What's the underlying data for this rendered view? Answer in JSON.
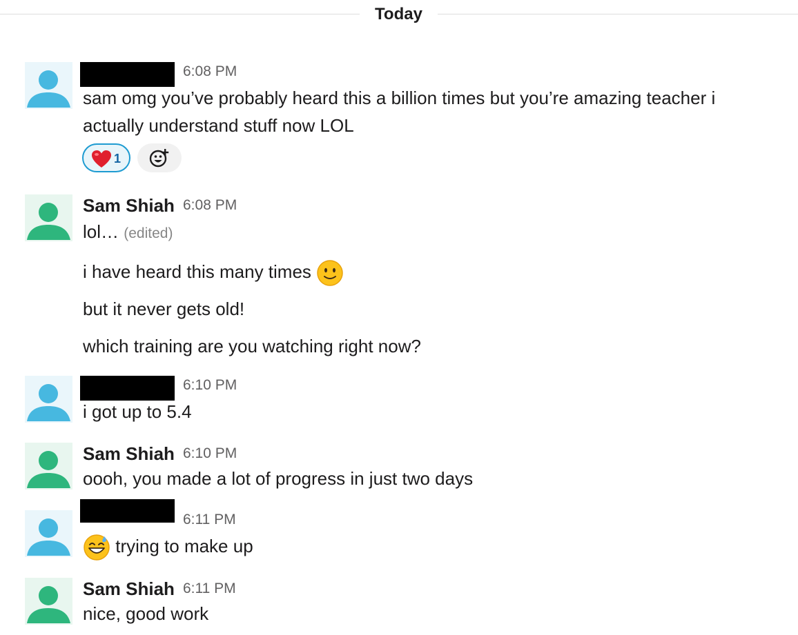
{
  "day_divider": "Today",
  "colors": {
    "avatar_blue": "#47b8e0",
    "avatar_green": "#2eb67d",
    "reaction_border": "#1d9bd1",
    "reaction_count": "#1264a3"
  },
  "messages": [
    {
      "author": "",
      "author_redacted": true,
      "time": "6:08 PM",
      "lines": [
        "sam omg you’ve probably heard this a billion times but you’re amazing teacher i",
        "actually understand stuff now LOL"
      ],
      "reactions": [
        {
          "emoji": "heart-emoji",
          "count": "1"
        }
      ]
    },
    {
      "author": "Sam Shiah",
      "time": "6:08 PM",
      "lines": [
        "lol…",
        "i have heard this many times",
        "but it never gets old!",
        "which training are you watching right now?"
      ],
      "edited": "(edited)"
    },
    {
      "author": "",
      "author_redacted": true,
      "time": "6:10 PM",
      "lines": [
        "i got up to 5.4"
      ]
    },
    {
      "author": "Sam Shiah",
      "time": "6:10 PM",
      "lines": [
        "oooh, you made a lot of progress in just two days"
      ]
    },
    {
      "author": "",
      "author_redacted": true,
      "time": "6:11 PM",
      "lines": [
        "trying to make up"
      ]
    },
    {
      "author": "Sam Shiah",
      "time": "6:11 PM",
      "lines": [
        "nice, good work"
      ]
    }
  ]
}
